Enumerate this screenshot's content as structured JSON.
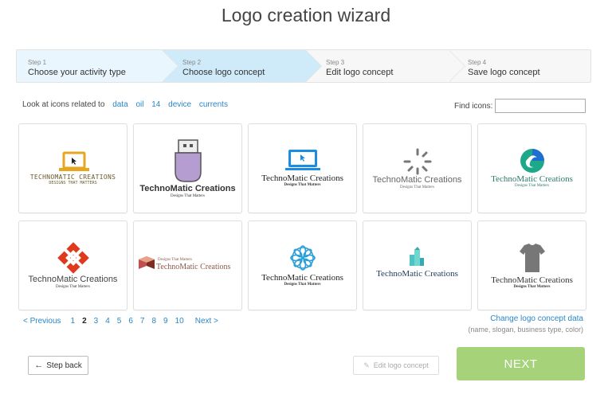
{
  "title": "Logo creation wizard",
  "steps": [
    {
      "num": "Step 1",
      "name": "Choose your activity type"
    },
    {
      "num": "Step 2",
      "name": "Choose logo concept"
    },
    {
      "num": "Step 3",
      "name": "Edit logo concept"
    },
    {
      "num": "Step 4",
      "name": "Save logo concept"
    }
  ],
  "related": {
    "label": "Look at icons related to",
    "tags": [
      "data",
      "oil",
      "14",
      "device",
      "currents"
    ]
  },
  "find": {
    "label": "Find icons:",
    "placeholder": ""
  },
  "logos": [
    {
      "brand": "TECHNOMATIC CREATIONS",
      "slogan": "DESIGNS THAT MATTERS",
      "icon": "laptop-icon"
    },
    {
      "brand": "TechnoMatic Creations",
      "slogan": "Designs That Matters",
      "icon": "usb-plug-icon"
    },
    {
      "brand": "TechnoMatic Creations",
      "slogan": "Designs That Matters",
      "icon": "monitor-icon"
    },
    {
      "brand": "TechnoMatic Creations",
      "slogan": "Designs That Matters",
      "icon": "loading-spinner-icon"
    },
    {
      "brand": "TechnoMatic Creations",
      "slogan": "Designs That Matters",
      "icon": "swirl-icon"
    },
    {
      "brand": "TechnoMatic Creations",
      "slogan": "Designs That Matters",
      "icon": "target-icon"
    },
    {
      "brand": "TechnoMatic Creations",
      "slogan": "Designs That Matters",
      "icon": "cube-icon"
    },
    {
      "brand": "TechnoMatic Creations",
      "slogan": "Designs That Matters",
      "icon": "flower-icon"
    },
    {
      "brand": "TechnoMatic Creations",
      "slogan": "",
      "icon": "buildings-icon"
    },
    {
      "brand": "TechnoMatic Creations",
      "slogan": "Designs That Matters",
      "icon": "tshirt-icon"
    }
  ],
  "pager": {
    "prev": "< Previous",
    "pages": [
      "1",
      "2",
      "3",
      "4",
      "5",
      "6",
      "7",
      "8",
      "9",
      "10"
    ],
    "current": "2",
    "next": "Next >"
  },
  "change": {
    "link": "Change logo concept data",
    "hint": "(name, slogan, business type, color)"
  },
  "buttons": {
    "back": "Step back",
    "edit": "Edit logo concept",
    "next": "NEXT"
  },
  "colors": {
    "accent_link": "#2a86c6",
    "next_button": "#a6d37a",
    "step_active": "#cfeaf9",
    "step_done": "#eaf6fd"
  }
}
